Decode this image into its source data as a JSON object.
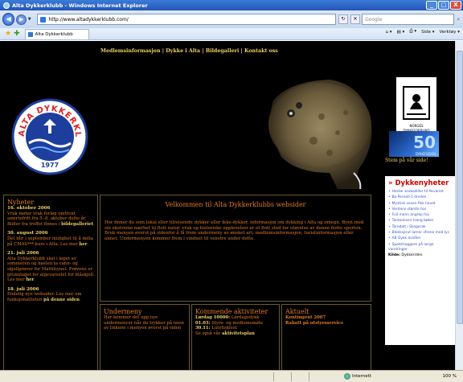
{
  "window": {
    "title": "Alta Dykkerklubb - Windows Internet Explorer",
    "min": "_",
    "max": "□",
    "close": "X"
  },
  "address": {
    "url": "http://www.altadykkerklubb.com/",
    "search_placeholder": "Google"
  },
  "tab": {
    "label": "Alta Dykkerklubb"
  },
  "commandbar": {
    "home": "⌂ ▾",
    "feeds": "▤ ▾",
    "print": "⎙ ▾",
    "page": "Side ▾",
    "tools": "Verktøy ▾"
  },
  "status": {
    "zone": "Internett",
    "zoom": "100 %"
  },
  "site": {
    "nav": {
      "item1": "Medlemsinformasjon",
      "item2": "Dykke i Alta",
      "item3": "Bildegalleri",
      "item4": "Kontakt oss",
      "sep": " | "
    },
    "logo": {
      "top_text": "ALTA DYKKERKLUBB",
      "year": "1977"
    },
    "emblem": {
      "text1": "NORGES",
      "text2": "DYKKEFORBUND"
    },
    "anniversary": {
      "number": "50",
      "brand": "DYKKESIDEN",
      "caption": "Stem på vår side!"
    },
    "news": {
      "heading": "Dykkenyheter",
      "items": [
        "Hester krokodiller til Akvariet",
        "Ba Pernell-1 dreilen",
        "Mystisk vesen fikk havet",
        "Verdens største hai",
        "Full mann angrep hai",
        "Tantonksen trang bøker",
        "Taredalt i Skagerak",
        "Blekksprut lamer sfrene med lys",
        "AB Dykk avslåer",
        "Spekkhoggere på lange vandringer"
      ],
      "source_label": "Kilde:",
      "source_value": "Dykkeriden"
    },
    "left": {
      "heading": "Nyheter",
      "posts": [
        {
          "date": "16. oktober 2006",
          "text": "Vrak møter vrak forløp omtrent smertefritt fra 5.-8. oktober dette år. Bilder fra treffet finnes i",
          "link": "bildegalleriet"
        },
        {
          "date": "30. august 2006",
          "text": "Det blir i september mulighet til å delta på CMAS***-kurs i Alta. Les mer",
          "link": "her"
        },
        {
          "date": "21. juli 2006",
          "text": "Alta Dykkerklubb skal i løpet av sommeren og høsten ta vann- og skjellprøver for Mattilsynet. Prøvene er grunnlaget for algevarselet for blåskjell. Les mer",
          "link": "her"
        },
        {
          "date": "18. juli 2006",
          "text": "Endelig nye websider. Les mer om funksjonaliteten",
          "link": "på denne siden"
        }
      ]
    },
    "welcome": {
      "heading": "Velkommen til Alta Dykkerklubbs websider",
      "p1": "Her finner du som lokal eller tilreisende dykker eller ikke-dykker, informasjon om dykking i Alta og omegn. Byen med sin ekstreme nærhet til flott natur, vrak og historiske opplevelser er et flott sted for utøvelse av denne flotte sporten.",
      "p2": "Bruk menyen øverst på sidenfor å få frem undermeny av ønsket art; medlemsinformasjon, turistinformasjon eller annet. Undermenyen kommer frem i vinduet til venstre under dette."
    },
    "undermeny": {
      "heading": "Undermeny",
      "text": "Her kommer det opp nye undermenyer når du trykker på noen av linkene i menyen øverst på siden"
    },
    "aktiviteter": {
      "heading": "Kommende aktiviteter",
      "lines": [
        {
          "date": "Lørdag 10000:",
          "text": "Lørdagsdykk"
        },
        {
          "date": "01.03:",
          "text": "Styre- og medlemsmøte"
        },
        {
          "date": "30.11:",
          "text": "Lutefiskfest"
        }
      ],
      "see_also": "Se også vår",
      "link": "aktivitetsplan"
    },
    "aktuelt": {
      "heading": "Aktuelt",
      "line1": "Kontingent 2007",
      "line2": "Rabatt på utstyrsservice"
    }
  },
  "colors": {
    "accent": "#e07a28",
    "gold": "#f0d060",
    "news_red": "#cc0000",
    "link_blue": "#3a57c2",
    "page_bg": "#000000"
  }
}
